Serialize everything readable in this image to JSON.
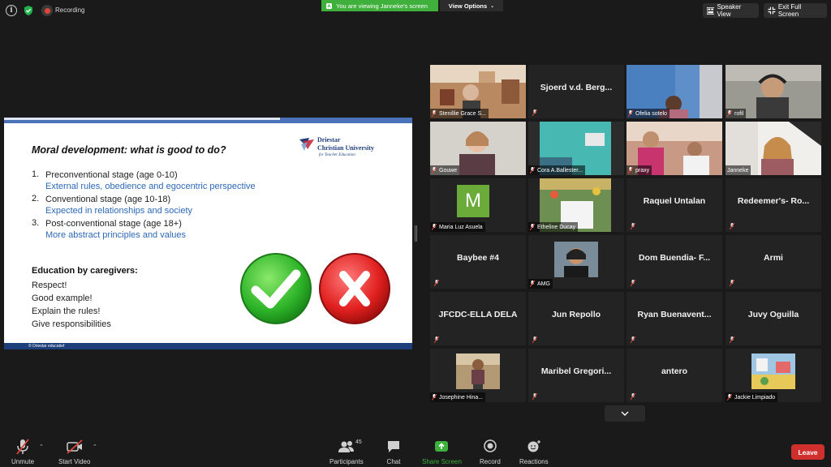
{
  "topbar": {
    "recording_label": "Recording",
    "share_banner": "You are viewing Janneke's screen",
    "view_options": "View Options",
    "speaker_view": "Speaker View",
    "exit_full_screen": "Exit Full Screen"
  },
  "slide": {
    "title": "Moral development: what is good to do?",
    "logo_line1": "Driestar",
    "logo_line2": "Christian University",
    "logo_sub": "for Teacher Education",
    "stages": [
      {
        "num": "1.",
        "name": "Preconventional stage (age 0-10)",
        "desc": "External rules, obedience and egocentric perspective"
      },
      {
        "num": "2.",
        "name": "Conventional stage (age 10-18)",
        "desc": "Expected in relationships and society"
      },
      {
        "num": "3.",
        "name": "Post-conventional stage (age 18+)",
        "desc": "More abstract principles and values"
      }
    ],
    "education_heading": "Education by caregivers:",
    "education_items": [
      "Respect!",
      "Good example!",
      "Explain the rules!",
      "Give responsibilities"
    ],
    "footer": "© Driestar educatief"
  },
  "gallery": {
    "tiles": [
      {
        "label": "Stenillie Grace S...",
        "display": ""
      },
      {
        "label": "",
        "display": "Sjoerd v.d. Berg..."
      },
      {
        "label": "Ofelia sotelo",
        "display": ""
      },
      {
        "label": "rofil",
        "display": ""
      },
      {
        "label": "Gouwe",
        "display": ""
      },
      {
        "label": "Cora A.Ballester...",
        "display": ""
      },
      {
        "label": "praxy",
        "display": ""
      },
      {
        "label": "Janneke",
        "display": ""
      },
      {
        "label": "Maria Luz Asuela",
        "display": "",
        "initial": "M"
      },
      {
        "label": "Etheline Ducay",
        "display": ""
      },
      {
        "label": "",
        "display": "Raquel Untalan"
      },
      {
        "label": "",
        "display": "Redeemer's- Ro..."
      },
      {
        "label": "",
        "display": "Baybee #4"
      },
      {
        "label": "AMG",
        "display": ""
      },
      {
        "label": "",
        "display": "Dom Buendia- F..."
      },
      {
        "label": "",
        "display": "Armi"
      },
      {
        "label": "",
        "display": "JFCDC-ELLA DELA"
      },
      {
        "label": "",
        "display": "Jun Repollo"
      },
      {
        "label": "",
        "display": "Ryan Buenavent..."
      },
      {
        "label": "",
        "display": "Juvy Oguilla"
      },
      {
        "label": "Josephine Hina...",
        "display": ""
      },
      {
        "label": "",
        "display": "Maribel Gregori..."
      },
      {
        "label": "",
        "display": "antero"
      },
      {
        "label": "Jackie Limpiado",
        "display": ""
      }
    ]
  },
  "toolbar": {
    "unmute": "Unmute",
    "start_video": "Start Video",
    "participants": "Participants",
    "participants_count": "45",
    "chat": "Chat",
    "share_screen": "Share Screen",
    "record": "Record",
    "reactions": "Reactions",
    "leave": "Leave"
  },
  "colors": {
    "share_green": "#3fb03b",
    "leave_red": "#d0302d",
    "slide_blue": "#2e68b5",
    "active_speaker": "#d9dc35"
  }
}
